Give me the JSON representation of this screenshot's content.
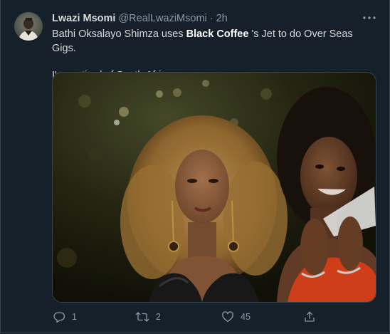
{
  "tweet": {
    "author": {
      "display_name": "Lwazi Msomi",
      "handle": "@RealLwaziMsomi",
      "avatar_icon": "avatar-photo"
    },
    "separator": "·",
    "time": "2h",
    "more_icon": "more-dots-icon",
    "text": {
      "line1_before": "Bathi Oksalayo Shimza uses ",
      "line1_bold": "Black Coffee",
      "line1_after": " 's Jet to do Over Seas Gigs.",
      "line2": "I'm so tired of South Africans."
    },
    "media": {
      "type": "photo"
    },
    "actions": {
      "reply": {
        "icon": "reply-icon",
        "count": "1"
      },
      "retweet": {
        "icon": "retweet-icon",
        "count": "2"
      },
      "like": {
        "icon": "heart-icon",
        "count": "45"
      },
      "share": {
        "icon": "share-icon"
      }
    }
  },
  "colors": {
    "background": "#15202b",
    "border": "#38444d",
    "text_primary": "#d9d9d9",
    "text_secondary": "#8b98a5"
  }
}
